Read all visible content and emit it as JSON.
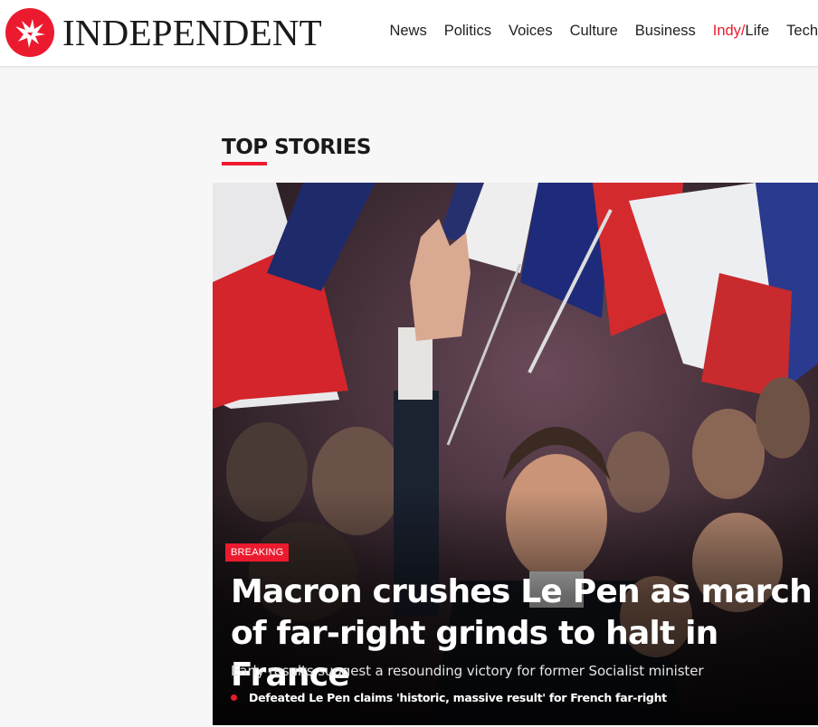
{
  "header": {
    "logo_text": "INDEPENDENT",
    "nav": [
      {
        "label": "News"
      },
      {
        "label": "Politics"
      },
      {
        "label": "Voices"
      },
      {
        "label": "Culture"
      },
      {
        "label": "Business"
      },
      {
        "label_accent": "Indy/",
        "label_rest": "Life"
      },
      {
        "label": "Tech"
      }
    ]
  },
  "section": {
    "title_accent": "TOP",
    "title_rest": " STORIES"
  },
  "lead_story": {
    "badge": "BREAKING",
    "headline": "Macron crushes Le Pen as march of far-right grinds to halt in France",
    "standfirst": "Early results suggest a resounding victory for former Socialist minister",
    "related": "Defeated Le Pen claims 'historic, massive result' for French far-right",
    "image_description_icon": "crowd-photo"
  },
  "colors": {
    "brand_red": "#ec1a2e",
    "text_dark": "#1a1a1a",
    "page_bg": "#f7f7f7"
  }
}
